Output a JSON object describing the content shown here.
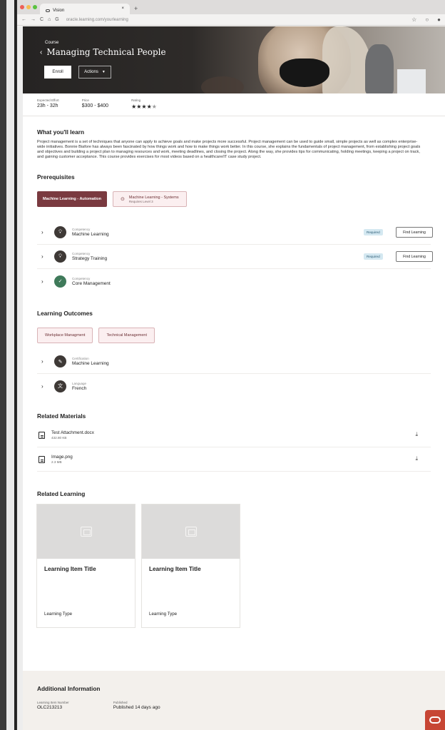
{
  "browser": {
    "tab_title": "Vision",
    "tab_close": "×",
    "new_tab": "+",
    "url": "oracle.learning.com/yourlearning",
    "traffic_colors": [
      "#ee5f56",
      "#f5bd4f",
      "#59c23f"
    ]
  },
  "hero": {
    "kicker": "Course",
    "title": "Managing Technical People",
    "enroll_label": "Enroll",
    "actions_label": "Actions"
  },
  "meta": {
    "effort_label": "Expected Effort",
    "effort_value": "23h - 32h",
    "price_label": "Price",
    "price_value": "$300 - $400",
    "rating_label": "Rating",
    "rating_filled": "★★★★",
    "rating_empty": "★",
    "rating_value": 4
  },
  "learn": {
    "heading": "What you'll learn",
    "description": "Project management is a set of techniques that anyone can apply to achieve goals and make projects more successful. Project management can be used to guide small, simple projects as well as complex enterprise-wide initiatives. Bonnie Biafore has always been fascinated by how things work and how to make things work better. In this course, she explains the fundamentals of project management, from establishing project goals and objectives and building a project plan to managing resources and work, meeting deadlines, and closing the project. Along the way, she provides tips for communicating, holding meetings, keeping a project on track, and gaining customer acceptance. This course provides exercises for most videos based on a healthcare/IT case study project."
  },
  "prereq": {
    "heading": "Prerequisites",
    "chip1": "Machine Learning - Automation",
    "chip2_title": "Machine Learning - Systems",
    "chip2_sub": "Requires Level 3",
    "rows": [
      {
        "kind": "Competency",
        "name": "Machine Learning",
        "badge": "Required",
        "button": "Find Learning"
      },
      {
        "kind": "Competency",
        "name": "Strategy Training",
        "badge": "Required",
        "button": "Find Learning"
      },
      {
        "kind": "Competency",
        "name": "Core Management"
      }
    ]
  },
  "outcomes": {
    "heading": "Learning Outcomes",
    "chip1": "Workplace Managment",
    "chip2": "Technical Management",
    "rows": [
      {
        "kind": "Certification",
        "name": "Machine Learning"
      },
      {
        "kind": "Language",
        "name": "French"
      }
    ]
  },
  "materials": {
    "heading": "Related Materials",
    "files": [
      {
        "name": "Test Attachment.docx",
        "size": "432.80 KB"
      },
      {
        "name": "Image.png",
        "size": "2.3 MB"
      }
    ]
  },
  "related": {
    "heading": "Related Learning",
    "cards": [
      {
        "title": "Learning Item Title",
        "type": "Learning Type"
      },
      {
        "title": "Learning Item Title",
        "type": "Learning Type"
      }
    ]
  },
  "additional": {
    "heading": "Additional Information",
    "number_label": "Learning Item Number",
    "number_value": "OLC213213",
    "published_label": "Published",
    "published_value": "Published 14 days ago"
  },
  "icons": [
    "back-icon",
    "chevron-down-icon",
    "lightbulb-icon",
    "check-icon",
    "wrench-icon",
    "translate-icon",
    "file-icon",
    "download-icon",
    "image-placeholder-icon",
    "oracle-logo-icon"
  ]
}
